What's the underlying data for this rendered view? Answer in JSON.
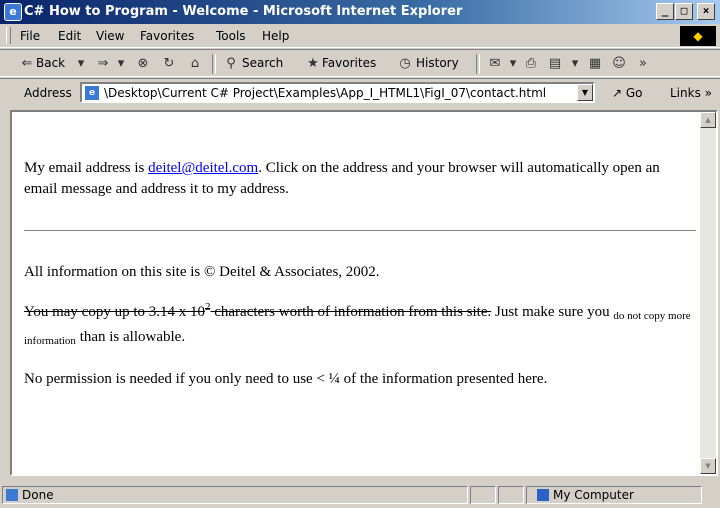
{
  "window": {
    "title": "C# How to Program - Welcome - Microsoft Internet Explorer",
    "minimize": "_",
    "maximize": "□",
    "close": "×"
  },
  "menu": [
    "File",
    "Edit",
    "View",
    "Favorites",
    "Tools",
    "Help"
  ],
  "toolbar": {
    "back": "Back",
    "search": "Search",
    "favorites": "Favorites",
    "history": "History"
  },
  "address": {
    "label": "Address",
    "url": "\\Desktop\\Current C# Project\\Examples\\App_I_HTML1\\FigI_07\\contact.html",
    "go": "Go",
    "links": "Links"
  },
  "page": {
    "p1_before": "My email address is ",
    "email": "deitel@deitel.com",
    "p1_after": ". Click on the address and your browser will automatically open an email message and address it to my address.",
    "p2": "All information on this site is © Deitel & Associates, 2002.",
    "p3_strike_a": "You may copy up to 3.14 x 10",
    "p3_sup": "2",
    "p3_strike_b": " characters worth of information from this site.",
    "p3_after": " Just make sure you ",
    "p3_small": "do not copy more information",
    "p3_end": " than is allowable.",
    "p4": "No permission is needed if you only need to use < ¼ of the information presented here."
  },
  "status": {
    "text": "Done",
    "zone": "My Computer"
  }
}
